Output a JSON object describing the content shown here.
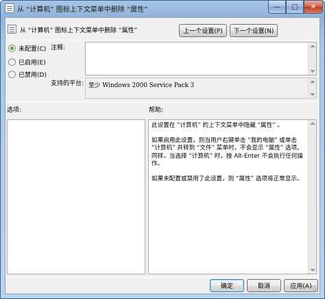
{
  "window": {
    "title": "从 “计算机” 图标上下文菜单中删除 “属性”",
    "controls": {
      "minimize": "—",
      "maximize": "□",
      "close": "✕"
    }
  },
  "header": {
    "policy_name": "从 “计算机” 图标上下文菜单中删除 “属性”",
    "prev_button": "上一个设置(P)",
    "next_button": "下一个设置(N)"
  },
  "state_options": [
    {
      "label": "未配置(C)",
      "checked": true
    },
    {
      "label": "已启用(E)",
      "checked": false
    },
    {
      "label": "已禁用(D)",
      "checked": false
    }
  ],
  "comment": {
    "label": "注释:",
    "value": ""
  },
  "supported": {
    "label": "支持的平台:",
    "value": "至少 Windows 2000 Service Pack 3"
  },
  "options_section": {
    "label": "选项:"
  },
  "help_section": {
    "label": "帮助:",
    "paragraphs": [
      "此设置在 “计算机” 的上下文菜单中隐藏 “属性” 。",
      "如果启用此设置，则当用户右键单击 “我的电脑” 或单击 “计算机” 并转到 “文件” 菜单时，不会显示 “属性” 选项。同样，当选择 “计算机” 时，按 Alt-Enter 不会执行任何操作。",
      "如果未配置或禁用了此设置，则 “属性” 选项将正常显示。"
    ]
  },
  "footer": {
    "ok_button": "确定",
    "cancel_button": "取消",
    "apply_button": "应用(A)"
  }
}
